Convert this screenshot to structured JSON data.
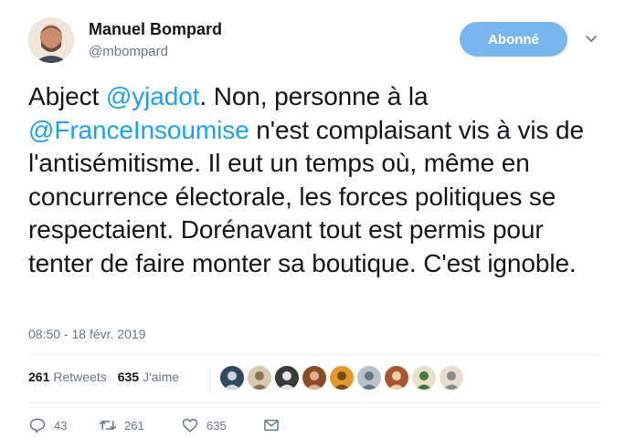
{
  "author": {
    "name": "Manuel Bompard",
    "handle": "@mbompard"
  },
  "follow_button": {
    "label": "Abonné"
  },
  "tweet": {
    "parts": [
      {
        "text": "Abject ",
        "mention": false
      },
      {
        "text": "@yjadot",
        "mention": true
      },
      {
        "text": ". Non, personne à la ",
        "mention": false
      },
      {
        "text": "@FranceInsoumise",
        "mention": true
      },
      {
        "text": " n'est complaisant vis à vis de l'antisémitisme. Il eut un temps où, même en concurrence électorale, les forces politiques se respectaient. Dorénavant tout est permis pour tenter de faire monter sa boutique. C'est ignoble.",
        "mention": false
      }
    ]
  },
  "timestamp": "08:50 - 18 févr. 2019",
  "stats": {
    "retweets_count": "261",
    "retweets_label": "Retweets",
    "likes_count": "635",
    "likes_label": "J'aime"
  },
  "likers": [
    {
      "bg": "#2f4a5c",
      "fg": "#cfd8dc"
    },
    {
      "bg": "#d8c9ae",
      "fg": "#8b7355"
    },
    {
      "bg": "#3a3a3a",
      "fg": "#e8e8e8"
    },
    {
      "bg": "#8a4b2a",
      "fg": "#e0b08a"
    },
    {
      "bg": "#e39a2c",
      "fg": "#7a4a12"
    },
    {
      "bg": "#b7c2cc",
      "fg": "#657786"
    },
    {
      "bg": "#a8572e",
      "fg": "#f0d0a0"
    },
    {
      "bg": "#e8e0c8",
      "fg": "#3c7a3c"
    },
    {
      "bg": "#e8dcd0",
      "fg": "#8a8a8a"
    }
  ],
  "actions": {
    "replies": "43",
    "retweets": "261",
    "likes": "635"
  },
  "icons": {
    "reply": "reply-icon",
    "retweet": "retweet-icon",
    "like": "heart-icon",
    "message": "envelope-icon",
    "menu": "chevron-down-icon"
  },
  "colors": {
    "accent": "#1da1f2",
    "follow_button": "#7ab7ee",
    "secondary_text": "#657786",
    "divider": "#e6ecf0"
  }
}
